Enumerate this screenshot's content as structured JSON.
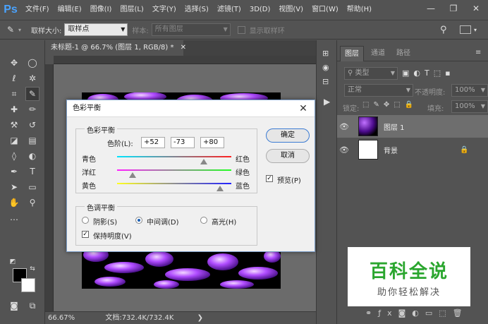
{
  "app": {
    "logo": "Ps"
  },
  "menu": [
    "文件(F)",
    "编辑(E)",
    "图像(I)",
    "图层(L)",
    "文字(Y)",
    "选择(S)",
    "滤镜(T)",
    "3D(D)",
    "视图(V)",
    "窗口(W)",
    "帮助(H)"
  ],
  "options": {
    "sample_size_label": "取样大小:",
    "sample_size_value": "取样点",
    "sample_label": "样本:",
    "sample_value": "所有图层",
    "show_ring_label": "显示取样环"
  },
  "document": {
    "tab_title": "未标题-1 @ 66.7% (图层 1, RGB/8) *",
    "zoom": "66.67%",
    "doc_info": "文档:732.4K/732.4K"
  },
  "layers_panel": {
    "tabs": [
      "图层",
      "通道",
      "路径"
    ],
    "filter_kind": "类型",
    "blend_mode": "正常",
    "opacity_label": "不透明度:",
    "opacity_value": "100%",
    "lock_label": "锁定:",
    "fill_label": "填充:",
    "fill_value": "100%",
    "layers": [
      {
        "name": "图层 1"
      },
      {
        "name": "背景"
      }
    ]
  },
  "dialog": {
    "title": "色彩平衡",
    "balance_group": "色彩平衡",
    "levels_label": "色阶(L):",
    "levels": [
      "+52",
      "-73",
      "+80"
    ],
    "sliders": [
      {
        "left": "青色",
        "right": "红色",
        "value": 52
      },
      {
        "left": "洋红",
        "right": "绿色",
        "value": -73
      },
      {
        "left": "黄色",
        "right": "蓝色",
        "value": 80
      }
    ],
    "tone_group": "色调平衡",
    "tones": [
      "阴影(S)",
      "中间调(D)",
      "高光(H)"
    ],
    "tone_selected": 1,
    "preserve_luminosity": "保持明度(V)",
    "ok": "确定",
    "cancel": "取消",
    "preview": "预览(P)",
    "colors": {
      "cyan": "#00e5ff",
      "red": "#ff2020",
      "magenta": "#ff20ff",
      "green": "#20ff20",
      "yellow": "#ffff20",
      "blue": "#2020ff"
    }
  },
  "watermark": {
    "title": "百科全说",
    "subtitle": "助你轻松解决"
  }
}
